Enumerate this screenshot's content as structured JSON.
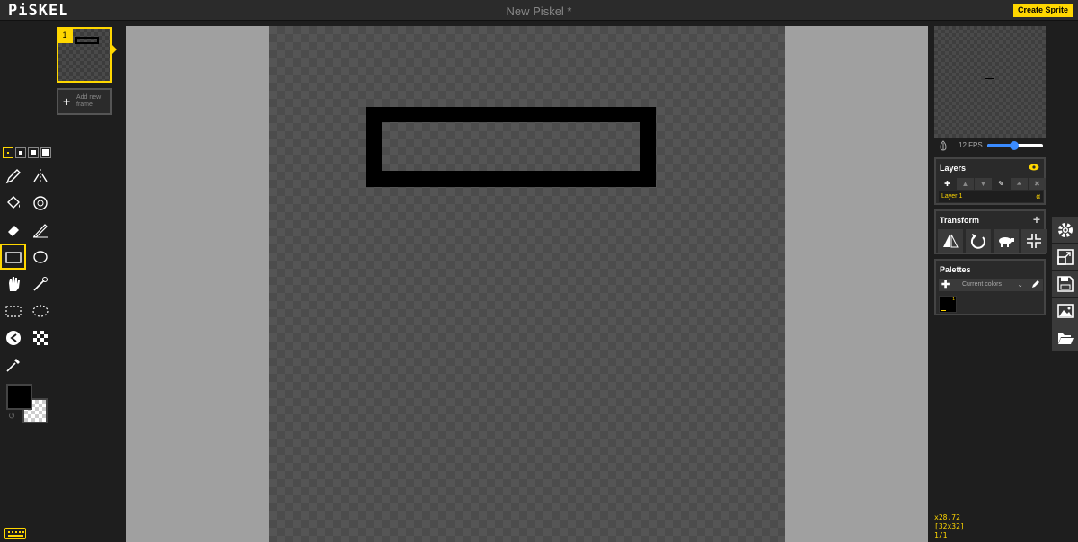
{
  "app": {
    "logo": "PiSKEL",
    "document_title": "New Piskel *",
    "create_sprite_label": "Create Sprite"
  },
  "frames": {
    "items": [
      {
        "number": "1"
      }
    ],
    "add_frame_label": "Add new frame"
  },
  "tools": {
    "pen_sizes": [
      1,
      2,
      3,
      4
    ],
    "selected_pen_size": 1,
    "items": [
      {
        "name": "pen-tool",
        "icon": "pen-icon"
      },
      {
        "name": "vertical-mirror-pen-tool",
        "icon": "mirror-pen-icon"
      },
      {
        "name": "paint-bucket-tool",
        "icon": "paint-bucket-icon"
      },
      {
        "name": "paint-all-same-color-tool",
        "icon": "magic-bucket-icon"
      },
      {
        "name": "eraser-tool",
        "icon": "eraser-icon"
      },
      {
        "name": "stroke-tool",
        "icon": "stroke-icon"
      },
      {
        "name": "rectangle-tool",
        "icon": "rectangle-icon",
        "active": true
      },
      {
        "name": "circle-tool",
        "icon": "circle-icon"
      },
      {
        "name": "move-tool",
        "icon": "hand-icon"
      },
      {
        "name": "shape-selection-tool",
        "icon": "magic-wand-icon"
      },
      {
        "name": "rectangle-selection-tool",
        "icon": "rect-select-icon"
      },
      {
        "name": "lasso-selection-tool",
        "icon": "lasso-icon"
      },
      {
        "name": "lighten-tool",
        "icon": "lighten-icon"
      },
      {
        "name": "dithering-tool",
        "icon": "dithering-icon"
      },
      {
        "name": "color-picker-tool",
        "icon": "eyedropper-icon"
      }
    ],
    "primary_color": "#000000",
    "secondary_color": "transparent"
  },
  "preview": {
    "fps_label": "12 FPS",
    "fps": 12
  },
  "layers": {
    "title": "Layers",
    "items": [
      {
        "name": "Layer 1",
        "alpha_label": "α"
      }
    ]
  },
  "transform": {
    "title": "Transform"
  },
  "palettes": {
    "title": "Palettes",
    "selected": "Current colors",
    "colors": [
      {
        "hex": "#000000",
        "index": "1"
      }
    ]
  },
  "status": {
    "zoom": "x28.72",
    "size": "[32x32]",
    "frame_counter": "1/1"
  },
  "colors": {
    "accent": "#ffd700",
    "background": "#1e1e1e",
    "canvas_bg": "#a0a0a0",
    "fps_slider": "#3a8bff"
  }
}
